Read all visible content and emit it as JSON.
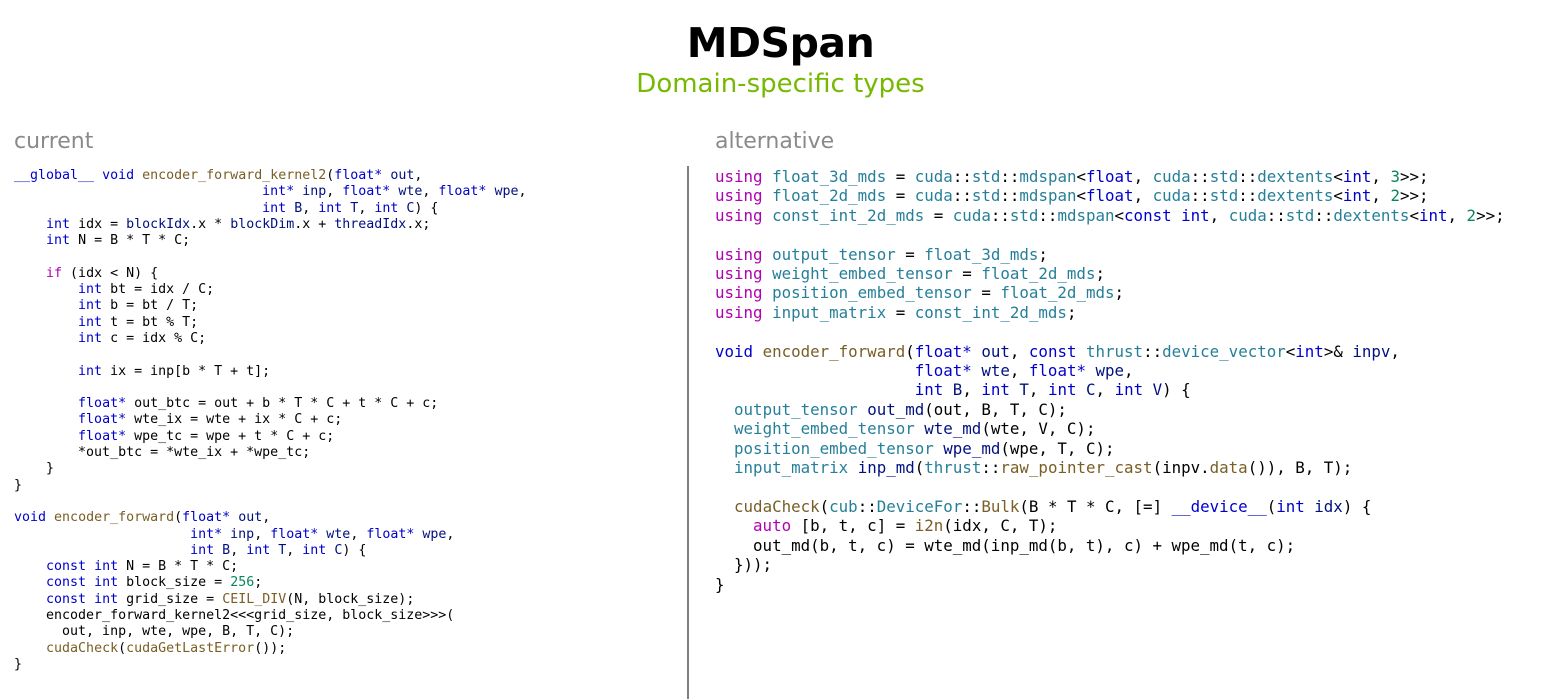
{
  "header": {
    "title": "MDSpan",
    "subtitle": "Domain-specific types"
  },
  "panels": {
    "left_label": "current",
    "right_label": "alternative"
  },
  "colors": {
    "accent_green": "#76b900",
    "label_gray": "#8a8a8a",
    "keyword": "#b000b0",
    "type": "#0000cc",
    "function": "#795e26",
    "builtin": "#267f99",
    "number": "#098658",
    "variable": "#001080"
  },
  "current_code": [
    [
      [
        "t",
        "__global__"
      ],
      [
        "p",
        " "
      ],
      [
        "t",
        "void"
      ],
      [
        "p",
        " "
      ],
      [
        "f",
        "encoder_forward_kernel2"
      ],
      [
        "p",
        "("
      ],
      [
        "t",
        "float*"
      ],
      [
        "p",
        " "
      ],
      [
        "v",
        "out"
      ],
      [
        "p",
        ","
      ]
    ],
    [
      [
        "p",
        "                               "
      ],
      [
        "t",
        "int*"
      ],
      [
        "p",
        " "
      ],
      [
        "v",
        "inp"
      ],
      [
        "p",
        ", "
      ],
      [
        "t",
        "float*"
      ],
      [
        "p",
        " "
      ],
      [
        "v",
        "wte"
      ],
      [
        "p",
        ", "
      ],
      [
        "t",
        "float*"
      ],
      [
        "p",
        " "
      ],
      [
        "v",
        "wpe"
      ],
      [
        "p",
        ","
      ]
    ],
    [
      [
        "p",
        "                               "
      ],
      [
        "t",
        "int"
      ],
      [
        "p",
        " "
      ],
      [
        "v",
        "B"
      ],
      [
        "p",
        ", "
      ],
      [
        "t",
        "int"
      ],
      [
        "p",
        " "
      ],
      [
        "v",
        "T"
      ],
      [
        "p",
        ", "
      ],
      [
        "t",
        "int"
      ],
      [
        "p",
        " "
      ],
      [
        "v",
        "C"
      ],
      [
        "p",
        ") {"
      ]
    ],
    [
      [
        "p",
        "    "
      ],
      [
        "t",
        "int"
      ],
      [
        "p",
        " idx = "
      ],
      [
        "v",
        "blockIdx"
      ],
      [
        "p",
        ".x * "
      ],
      [
        "v",
        "blockDim"
      ],
      [
        "p",
        ".x + "
      ],
      [
        "v",
        "threadIdx"
      ],
      [
        "p",
        ".x;"
      ]
    ],
    [
      [
        "p",
        "    "
      ],
      [
        "t",
        "int"
      ],
      [
        "p",
        " N = B * T * C;"
      ]
    ],
    [],
    [
      [
        "p",
        "    "
      ],
      [
        "k",
        "if"
      ],
      [
        "p",
        " (idx < N) {"
      ]
    ],
    [
      [
        "p",
        "        "
      ],
      [
        "t",
        "int"
      ],
      [
        "p",
        " bt = idx / C;"
      ]
    ],
    [
      [
        "p",
        "        "
      ],
      [
        "t",
        "int"
      ],
      [
        "p",
        " b = bt / T;"
      ]
    ],
    [
      [
        "p",
        "        "
      ],
      [
        "t",
        "int"
      ],
      [
        "p",
        " t = bt % T;"
      ]
    ],
    [
      [
        "p",
        "        "
      ],
      [
        "t",
        "int"
      ],
      [
        "p",
        " c = idx % C;"
      ]
    ],
    [],
    [
      [
        "p",
        "        "
      ],
      [
        "t",
        "int"
      ],
      [
        "p",
        " ix = inp[b * T + t];"
      ]
    ],
    [],
    [
      [
        "p",
        "        "
      ],
      [
        "t",
        "float*"
      ],
      [
        "p",
        " out_btc = out + b * T * C + t * C + c;"
      ]
    ],
    [
      [
        "p",
        "        "
      ],
      [
        "t",
        "float*"
      ],
      [
        "p",
        " wte_ix = wte + ix * C + c;"
      ]
    ],
    [
      [
        "p",
        "        "
      ],
      [
        "t",
        "float*"
      ],
      [
        "p",
        " wpe_tc = wpe + t * C + c;"
      ]
    ],
    [
      [
        "p",
        "        *out_btc = *wte_ix + *wpe_tc;"
      ]
    ],
    [
      [
        "p",
        "    }"
      ]
    ],
    [
      [
        "p",
        "}"
      ]
    ],
    [],
    [
      [
        "t",
        "void"
      ],
      [
        "p",
        " "
      ],
      [
        "f",
        "encoder_forward"
      ],
      [
        "p",
        "("
      ],
      [
        "t",
        "float*"
      ],
      [
        "p",
        " "
      ],
      [
        "v",
        "out"
      ],
      [
        "p",
        ","
      ]
    ],
    [
      [
        "p",
        "                      "
      ],
      [
        "t",
        "int*"
      ],
      [
        "p",
        " "
      ],
      [
        "v",
        "inp"
      ],
      [
        "p",
        ", "
      ],
      [
        "t",
        "float*"
      ],
      [
        "p",
        " "
      ],
      [
        "v",
        "wte"
      ],
      [
        "p",
        ", "
      ],
      [
        "t",
        "float*"
      ],
      [
        "p",
        " "
      ],
      [
        "v",
        "wpe"
      ],
      [
        "p",
        ","
      ]
    ],
    [
      [
        "p",
        "                      "
      ],
      [
        "t",
        "int"
      ],
      [
        "p",
        " "
      ],
      [
        "v",
        "B"
      ],
      [
        "p",
        ", "
      ],
      [
        "t",
        "int"
      ],
      [
        "p",
        " "
      ],
      [
        "v",
        "T"
      ],
      [
        "p",
        ", "
      ],
      [
        "t",
        "int"
      ],
      [
        "p",
        " "
      ],
      [
        "v",
        "C"
      ],
      [
        "p",
        ") {"
      ]
    ],
    [
      [
        "p",
        "    "
      ],
      [
        "t",
        "const"
      ],
      [
        "p",
        " "
      ],
      [
        "t",
        "int"
      ],
      [
        "p",
        " N = B * T * C;"
      ]
    ],
    [
      [
        "p",
        "    "
      ],
      [
        "t",
        "const"
      ],
      [
        "p",
        " "
      ],
      [
        "t",
        "int"
      ],
      [
        "p",
        " block_size = "
      ],
      [
        "n",
        "256"
      ],
      [
        "p",
        ";"
      ]
    ],
    [
      [
        "p",
        "    "
      ],
      [
        "t",
        "const"
      ],
      [
        "p",
        " "
      ],
      [
        "t",
        "int"
      ],
      [
        "p",
        " grid_size = "
      ],
      [
        "f",
        "CEIL_DIV"
      ],
      [
        "p",
        "(N, block_size);"
      ]
    ],
    [
      [
        "p",
        "    encoder_forward_kernel2<<<grid_size, block_size>>>("
      ]
    ],
    [
      [
        "p",
        "      out, inp, wte, wpe, B, T, C);"
      ]
    ],
    [
      [
        "p",
        "    "
      ],
      [
        "f",
        "cudaCheck"
      ],
      [
        "p",
        "("
      ],
      [
        "f",
        "cudaGetLastError"
      ],
      [
        "p",
        "());"
      ]
    ],
    [
      [
        "p",
        "}"
      ]
    ]
  ],
  "alternative_code": [
    [
      [
        "k",
        "using"
      ],
      [
        "p",
        " "
      ],
      [
        "c",
        "float_3d_mds"
      ],
      [
        "p",
        " = "
      ],
      [
        "c",
        "cuda"
      ],
      [
        "p",
        "::"
      ],
      [
        "c",
        "std"
      ],
      [
        "p",
        "::"
      ],
      [
        "c",
        "mdspan"
      ],
      [
        "p",
        "<"
      ],
      [
        "t",
        "float"
      ],
      [
        "p",
        ", "
      ],
      [
        "c",
        "cuda"
      ],
      [
        "p",
        "::"
      ],
      [
        "c",
        "std"
      ],
      [
        "p",
        "::"
      ],
      [
        "c",
        "dextents"
      ],
      [
        "p",
        "<"
      ],
      [
        "t",
        "int"
      ],
      [
        "p",
        ", "
      ],
      [
        "n",
        "3"
      ],
      [
        "p",
        ">>;"
      ]
    ],
    [
      [
        "k",
        "using"
      ],
      [
        "p",
        " "
      ],
      [
        "c",
        "float_2d_mds"
      ],
      [
        "p",
        " = "
      ],
      [
        "c",
        "cuda"
      ],
      [
        "p",
        "::"
      ],
      [
        "c",
        "std"
      ],
      [
        "p",
        "::"
      ],
      [
        "c",
        "mdspan"
      ],
      [
        "p",
        "<"
      ],
      [
        "t",
        "float"
      ],
      [
        "p",
        ", "
      ],
      [
        "c",
        "cuda"
      ],
      [
        "p",
        "::"
      ],
      [
        "c",
        "std"
      ],
      [
        "p",
        "::"
      ],
      [
        "c",
        "dextents"
      ],
      [
        "p",
        "<"
      ],
      [
        "t",
        "int"
      ],
      [
        "p",
        ", "
      ],
      [
        "n",
        "2"
      ],
      [
        "p",
        ">>;"
      ]
    ],
    [
      [
        "k",
        "using"
      ],
      [
        "p",
        " "
      ],
      [
        "c",
        "const_int_2d_mds"
      ],
      [
        "p",
        " = "
      ],
      [
        "c",
        "cuda"
      ],
      [
        "p",
        "::"
      ],
      [
        "c",
        "std"
      ],
      [
        "p",
        "::"
      ],
      [
        "c",
        "mdspan"
      ],
      [
        "p",
        "<"
      ],
      [
        "t",
        "const"
      ],
      [
        "p",
        " "
      ],
      [
        "t",
        "int"
      ],
      [
        "p",
        ", "
      ],
      [
        "c",
        "cuda"
      ],
      [
        "p",
        "::"
      ],
      [
        "c",
        "std"
      ],
      [
        "p",
        "::"
      ],
      [
        "c",
        "dextents"
      ],
      [
        "p",
        "<"
      ],
      [
        "t",
        "int"
      ],
      [
        "p",
        ", "
      ],
      [
        "n",
        "2"
      ],
      [
        "p",
        ">>;"
      ]
    ],
    [],
    [
      [
        "k",
        "using"
      ],
      [
        "p",
        " "
      ],
      [
        "c",
        "output_tensor"
      ],
      [
        "p",
        " = "
      ],
      [
        "c",
        "float_3d_mds"
      ],
      [
        "p",
        ";"
      ]
    ],
    [
      [
        "k",
        "using"
      ],
      [
        "p",
        " "
      ],
      [
        "c",
        "weight_embed_tensor"
      ],
      [
        "p",
        " = "
      ],
      [
        "c",
        "float_2d_mds"
      ],
      [
        "p",
        ";"
      ]
    ],
    [
      [
        "k",
        "using"
      ],
      [
        "p",
        " "
      ],
      [
        "c",
        "position_embed_tensor"
      ],
      [
        "p",
        " = "
      ],
      [
        "c",
        "float_2d_mds"
      ],
      [
        "p",
        ";"
      ]
    ],
    [
      [
        "k",
        "using"
      ],
      [
        "p",
        " "
      ],
      [
        "c",
        "input_matrix"
      ],
      [
        "p",
        " = "
      ],
      [
        "c",
        "const_int_2d_mds"
      ],
      [
        "p",
        ";"
      ]
    ],
    [],
    [
      [
        "t",
        "void"
      ],
      [
        "p",
        " "
      ],
      [
        "f",
        "encoder_forward"
      ],
      [
        "p",
        "("
      ],
      [
        "t",
        "float*"
      ],
      [
        "p",
        " "
      ],
      [
        "v",
        "out"
      ],
      [
        "p",
        ", "
      ],
      [
        "t",
        "const"
      ],
      [
        "p",
        " "
      ],
      [
        "c",
        "thrust"
      ],
      [
        "p",
        "::"
      ],
      [
        "c",
        "device_vector"
      ],
      [
        "p",
        "<"
      ],
      [
        "t",
        "int"
      ],
      [
        "p",
        ">& "
      ],
      [
        "v",
        "inpv"
      ],
      [
        "p",
        ","
      ]
    ],
    [
      [
        "p",
        "                     "
      ],
      [
        "t",
        "float*"
      ],
      [
        "p",
        " "
      ],
      [
        "v",
        "wte"
      ],
      [
        "p",
        ", "
      ],
      [
        "t",
        "float*"
      ],
      [
        "p",
        " "
      ],
      [
        "v",
        "wpe"
      ],
      [
        "p",
        ","
      ]
    ],
    [
      [
        "p",
        "                     "
      ],
      [
        "t",
        "int"
      ],
      [
        "p",
        " "
      ],
      [
        "v",
        "B"
      ],
      [
        "p",
        ", "
      ],
      [
        "t",
        "int"
      ],
      [
        "p",
        " "
      ],
      [
        "v",
        "T"
      ],
      [
        "p",
        ", "
      ],
      [
        "t",
        "int"
      ],
      [
        "p",
        " "
      ],
      [
        "v",
        "C"
      ],
      [
        "p",
        ", "
      ],
      [
        "t",
        "int"
      ],
      [
        "p",
        " "
      ],
      [
        "v",
        "V"
      ],
      [
        "p",
        ") {"
      ]
    ],
    [
      [
        "p",
        "  "
      ],
      [
        "c",
        "output_tensor"
      ],
      [
        "p",
        " "
      ],
      [
        "v",
        "out_md"
      ],
      [
        "p",
        "(out, B, T, C);"
      ]
    ],
    [
      [
        "p",
        "  "
      ],
      [
        "c",
        "weight_embed_tensor"
      ],
      [
        "p",
        " "
      ],
      [
        "v",
        "wte_md"
      ],
      [
        "p",
        "(wte, V, C);"
      ]
    ],
    [
      [
        "p",
        "  "
      ],
      [
        "c",
        "position_embed_tensor"
      ],
      [
        "p",
        " "
      ],
      [
        "v",
        "wpe_md"
      ],
      [
        "p",
        "(wpe, T, C);"
      ]
    ],
    [
      [
        "p",
        "  "
      ],
      [
        "c",
        "input_matrix"
      ],
      [
        "p",
        " "
      ],
      [
        "v",
        "inp_md"
      ],
      [
        "p",
        "("
      ],
      [
        "c",
        "thrust"
      ],
      [
        "p",
        "::"
      ],
      [
        "f",
        "raw_pointer_cast"
      ],
      [
        "p",
        "(inpv."
      ],
      [
        "f",
        "data"
      ],
      [
        "p",
        "()), B, T);"
      ]
    ],
    [],
    [
      [
        "p",
        "  "
      ],
      [
        "f",
        "cudaCheck"
      ],
      [
        "p",
        "("
      ],
      [
        "c",
        "cub"
      ],
      [
        "p",
        "::"
      ],
      [
        "c",
        "DeviceFor"
      ],
      [
        "p",
        "::"
      ],
      [
        "f",
        "Bulk"
      ],
      [
        "p",
        "(B * T * C, [=] "
      ],
      [
        "t",
        "__device__"
      ],
      [
        "p",
        "("
      ],
      [
        "t",
        "int"
      ],
      [
        "p",
        " "
      ],
      [
        "v",
        "idx"
      ],
      [
        "p",
        ") {"
      ]
    ],
    [
      [
        "p",
        "    "
      ],
      [
        "k",
        "auto"
      ],
      [
        "p",
        " [b, t, c] = "
      ],
      [
        "f",
        "i2n"
      ],
      [
        "p",
        "(idx, C, T);"
      ]
    ],
    [
      [
        "p",
        "    out_md(b, t, c) = wte_md(inp_md(b, t), c) + wpe_md(t, c);"
      ]
    ],
    [
      [
        "p",
        "  }));"
      ]
    ],
    [
      [
        "p",
        "}"
      ]
    ]
  ]
}
